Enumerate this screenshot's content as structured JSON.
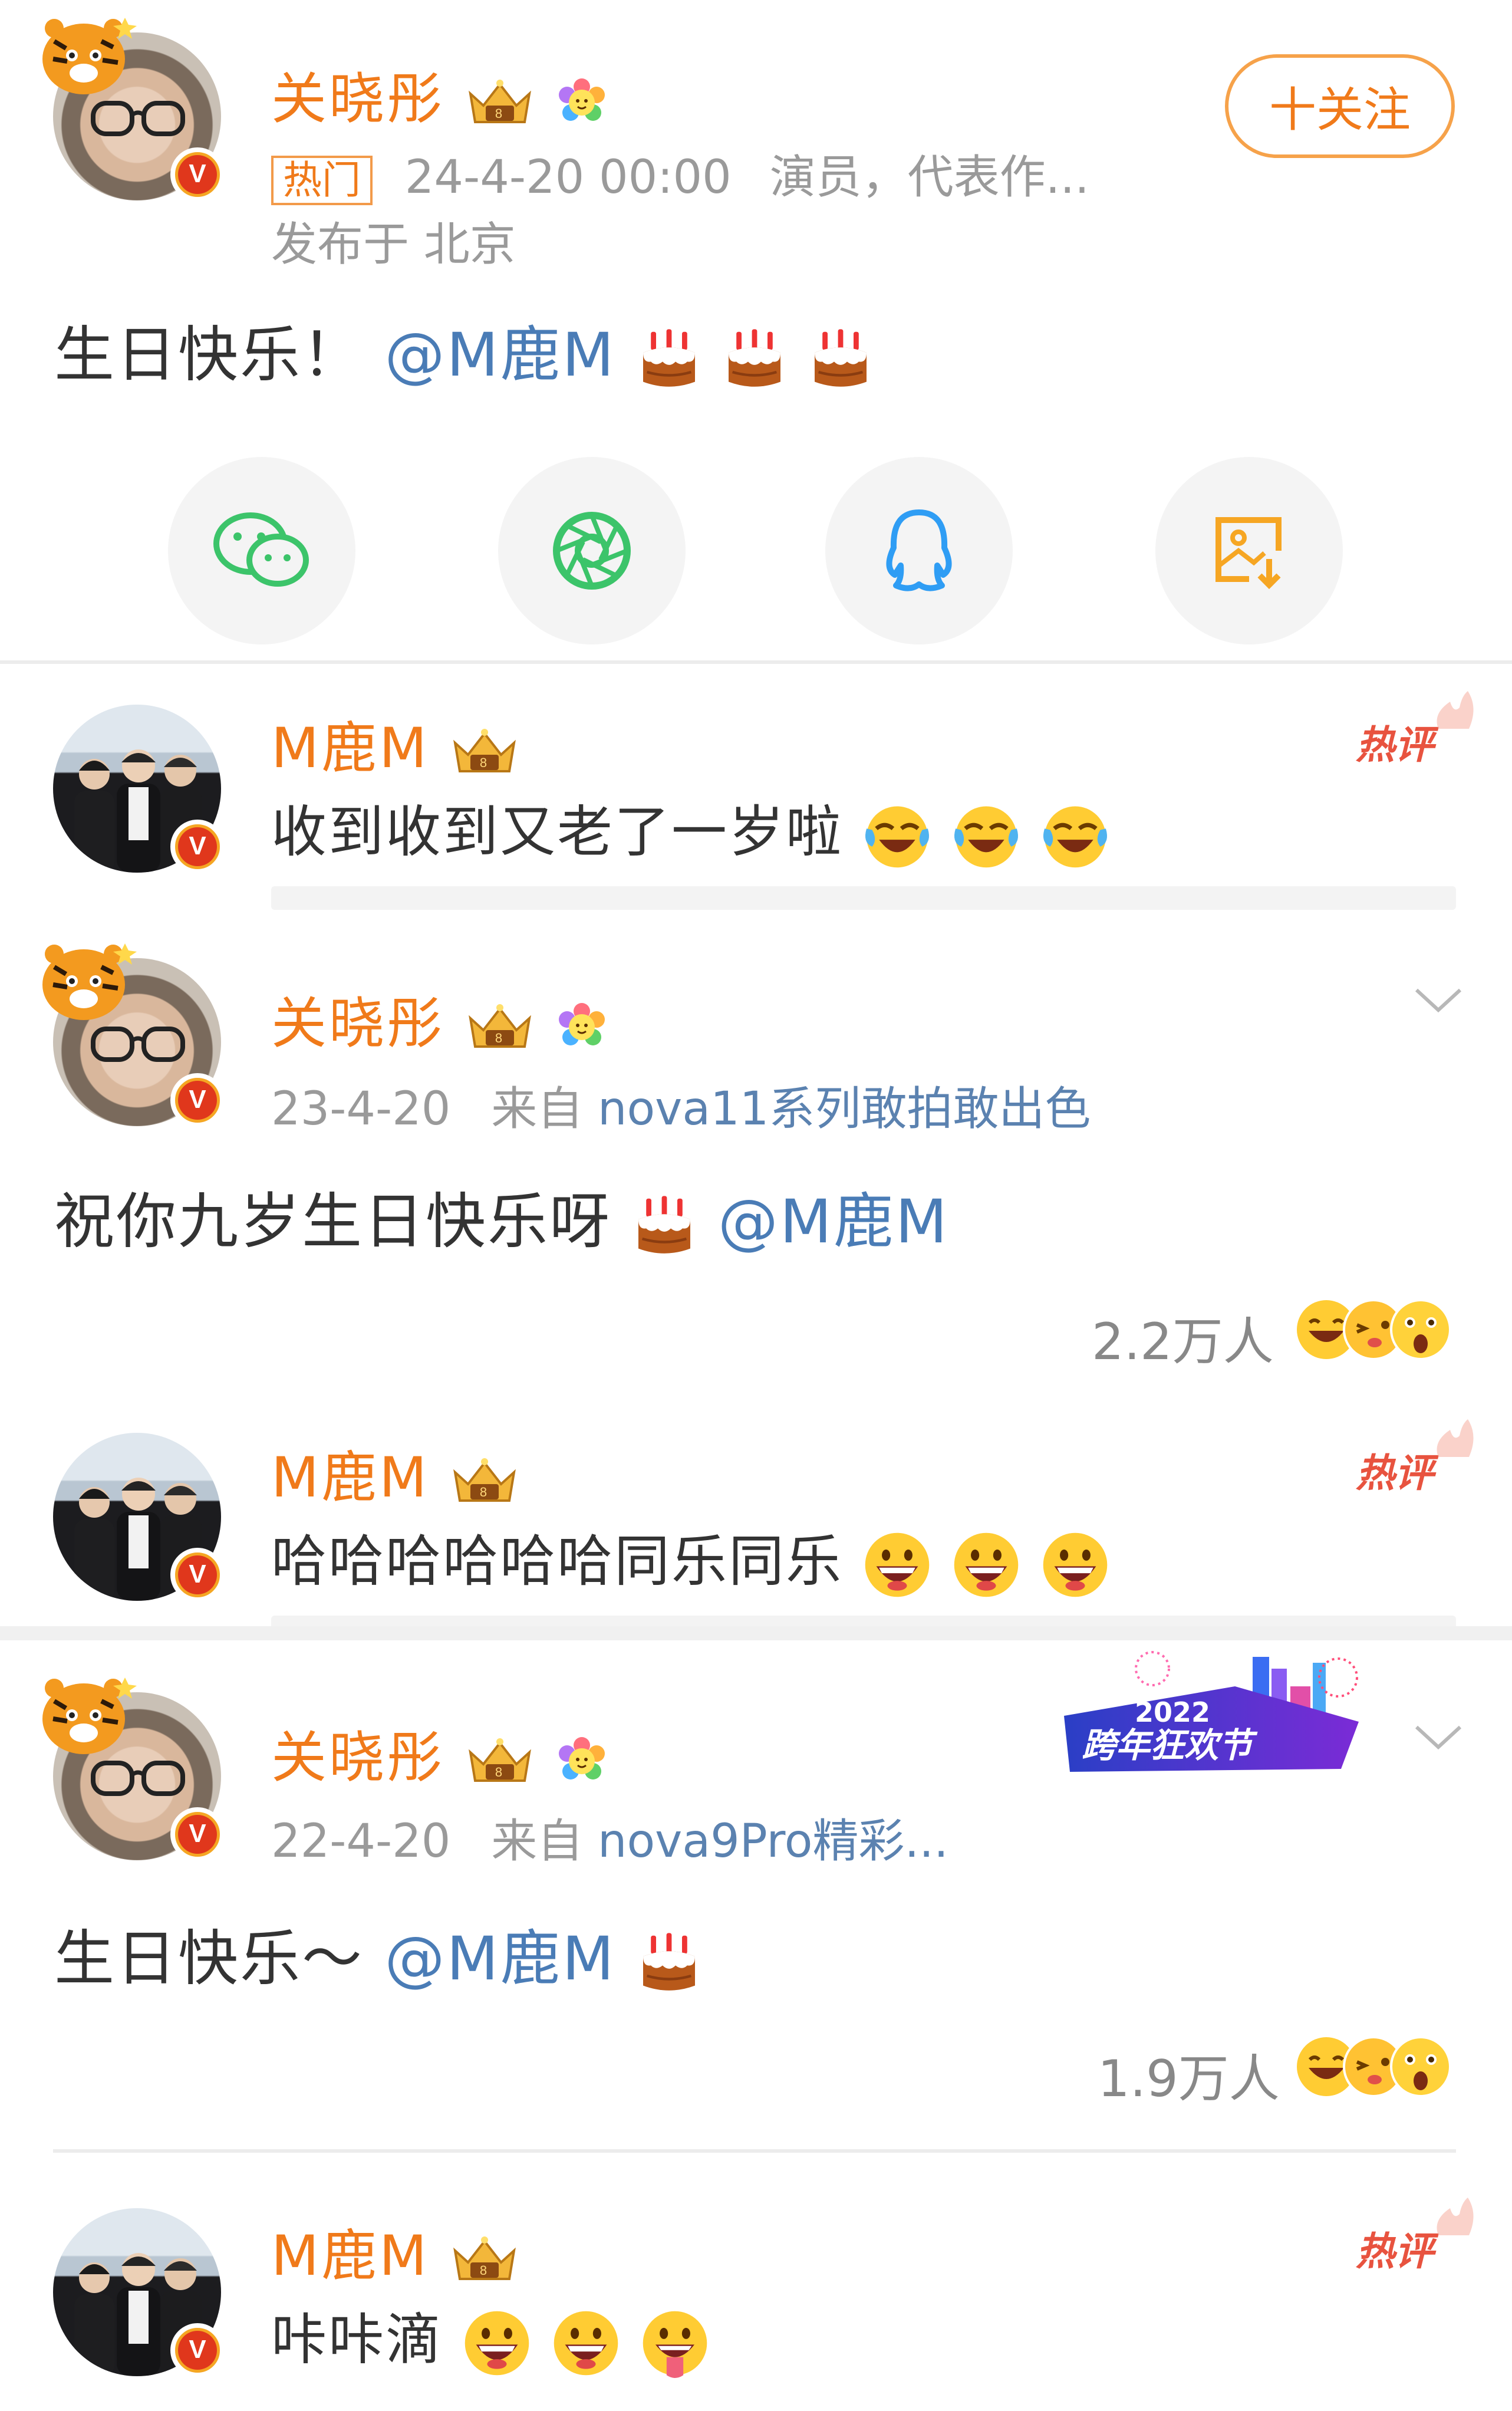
{
  "post": {
    "author": "关晓彤",
    "tag": "热门",
    "time": "24-4-20 00:00",
    "bio": "演员，代表作...",
    "location": "发布于 北京",
    "text": "生日快乐！",
    "mention": "@M鹿M",
    "follow_label": "十关注"
  },
  "share": {
    "items": [
      {
        "icon": "wechat-icon"
      },
      {
        "icon": "moments-icon"
      },
      {
        "icon": "qq-icon"
      },
      {
        "icon": "save-image-icon"
      }
    ]
  },
  "threads": [
    {
      "reply": {
        "author": "M鹿M",
        "hot_label": "热评",
        "text": "收到收到又老了一岁啦"
      }
    },
    {
      "post": {
        "author": "关晓彤",
        "date": "23-4-20",
        "source_prefix": "来自 ",
        "source": "nova11系列敢拍敢出色",
        "text": "祝你九岁生日快乐呀",
        "mention": "@M鹿M",
        "count": "2.2万人"
      },
      "reply": {
        "author": "M鹿M",
        "hot_label": "热评",
        "text": "哈哈哈哈哈哈同乐同乐"
      }
    },
    {
      "post": {
        "author": "关晓彤",
        "date": "22-4-20",
        "source_prefix": "来自 ",
        "source": "nova9Pro精彩...",
        "text": "生日快乐～",
        "mention": "@M鹿M",
        "count": "1.9万人",
        "banner": {
          "year": "2022",
          "title": "跨年狂欢节"
        }
      },
      "reply": {
        "author": "M鹿M",
        "hot_label": "热评",
        "text": "咔咔滴"
      }
    }
  ],
  "colors": {
    "accent": "#f07a1a",
    "mention": "#4a7cb6",
    "hot": "#e8533f",
    "verified": "#e0371c"
  }
}
